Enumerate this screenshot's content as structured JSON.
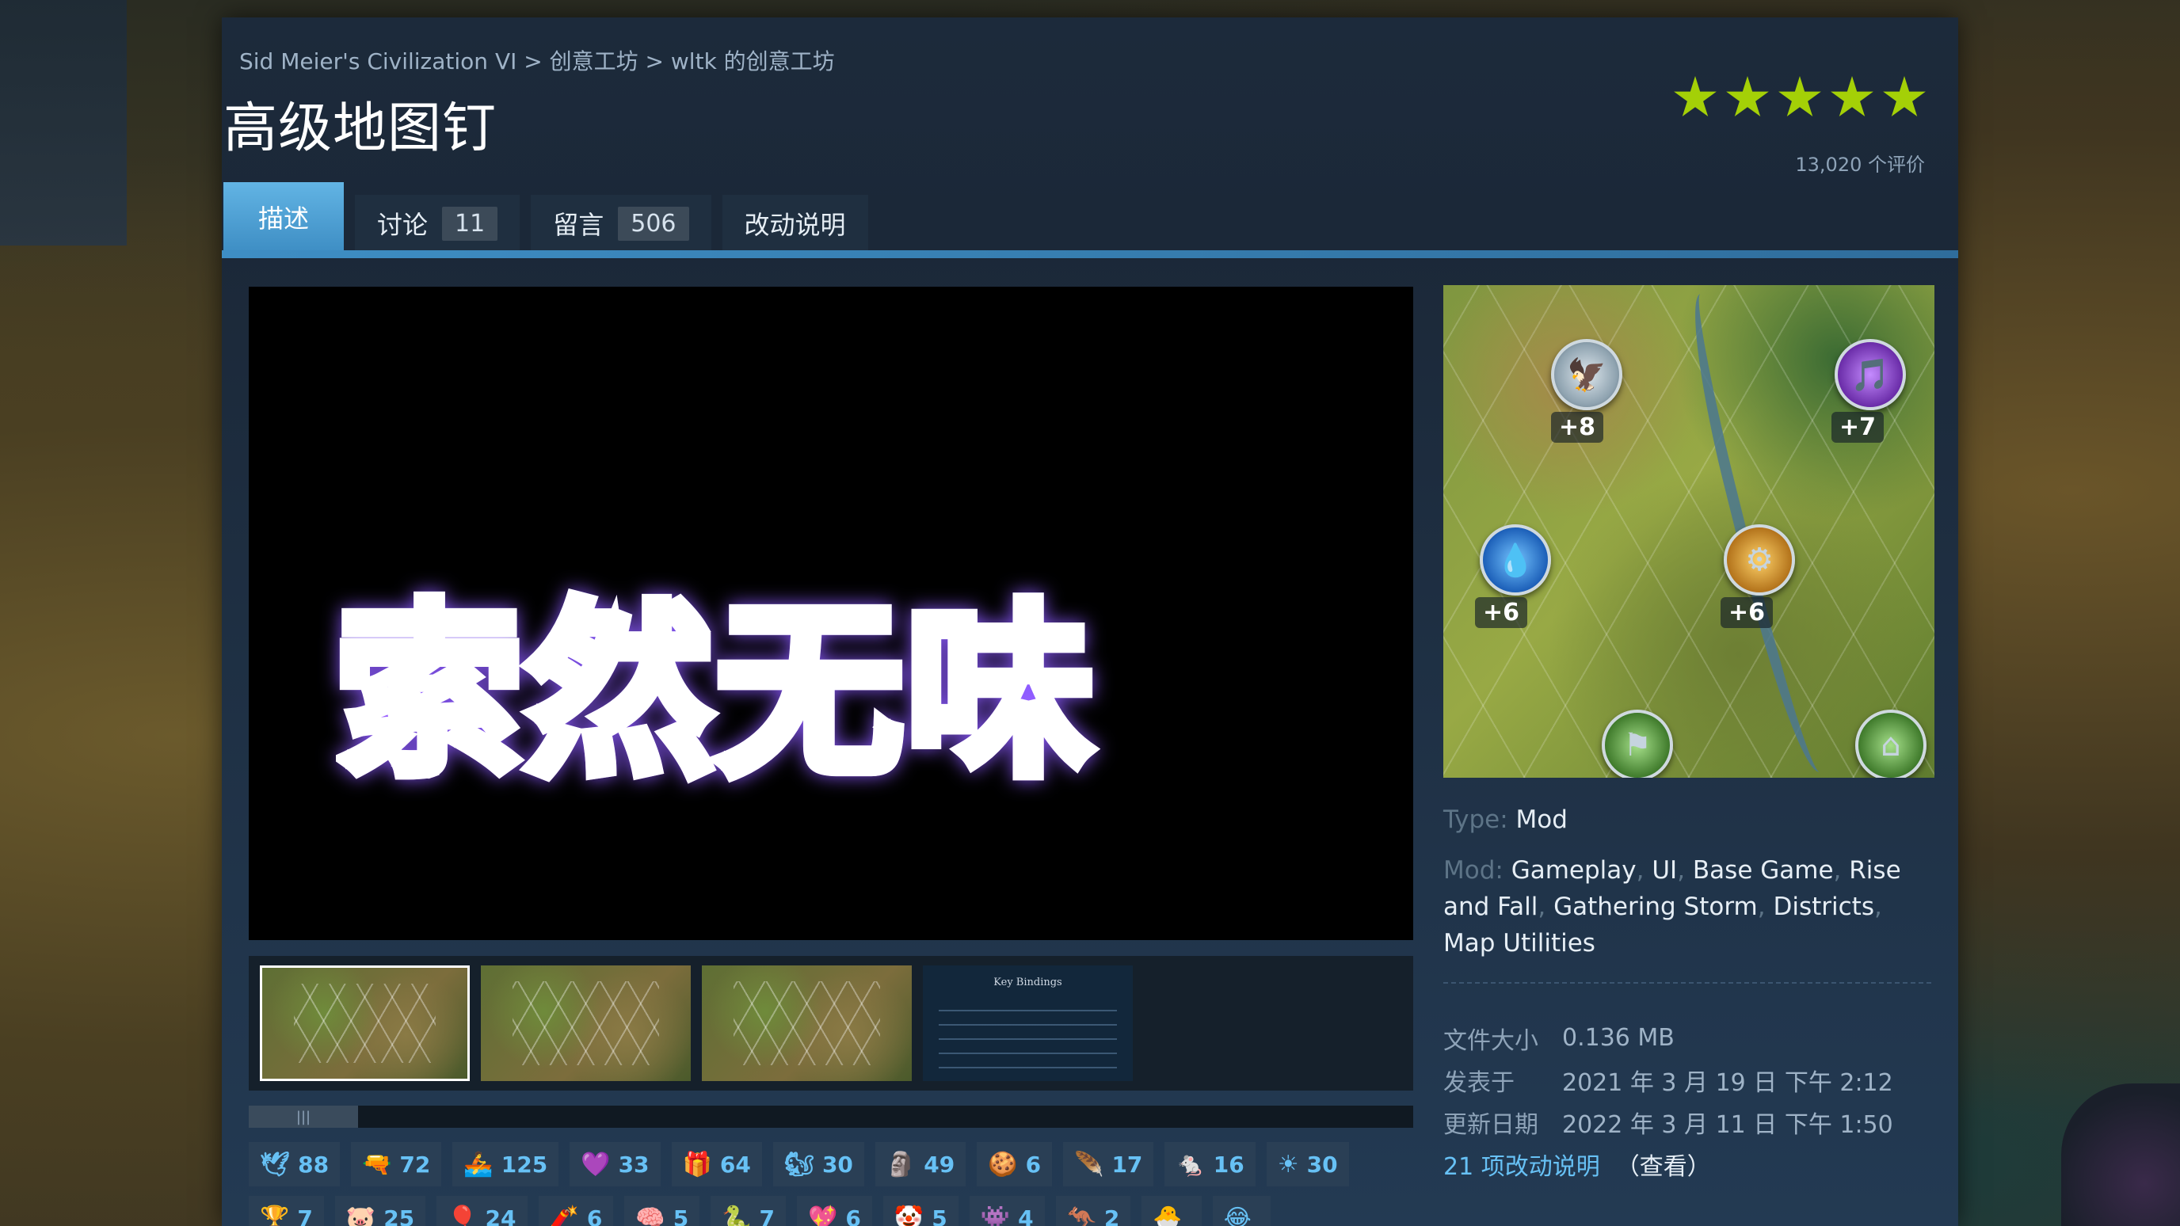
{
  "breadcrumb": {
    "game": "Sid Meier's Civilization VI",
    "sep1": " > ",
    "workshop": "创意工坊",
    "sep2": " > ",
    "author": "wltk 的创意工坊"
  },
  "item": {
    "title": "高级地图钉",
    "rating_count": "13,020 个评价",
    "stars": 5
  },
  "tabs": [
    {
      "label": "描述",
      "count": ""
    },
    {
      "label": "讨论",
      "count": "11"
    },
    {
      "label": "留言",
      "count": "506"
    },
    {
      "label": "改动说明",
      "count": ""
    }
  ],
  "media": {
    "overlay_caption": "索然无味",
    "keybind_thumb_title": "Key Bindings",
    "scroll_thumb": "|||"
  },
  "awards": [
    {
      "icon": "🕊",
      "count": "88"
    },
    {
      "icon": "🔫",
      "count": "72"
    },
    {
      "icon": "🚣",
      "count": "125"
    },
    {
      "icon": "💜",
      "count": "33"
    },
    {
      "icon": "🎁",
      "count": "64"
    },
    {
      "icon": "🐿",
      "count": "30"
    },
    {
      "icon": "🗿",
      "count": "49"
    },
    {
      "icon": "🍪",
      "count": "6"
    },
    {
      "icon": "🪶",
      "count": "17"
    },
    {
      "icon": "🐁",
      "count": "16"
    },
    {
      "icon": "☀",
      "count": "30"
    },
    {
      "icon": "🏆",
      "count": "7"
    },
    {
      "icon": "🐷",
      "count": "25"
    },
    {
      "icon": "🎈",
      "count": "24"
    },
    {
      "icon": "🧨",
      "count": "6"
    },
    {
      "icon": "🧠",
      "count": "5"
    },
    {
      "icon": "🐍",
      "count": "7"
    },
    {
      "icon": "💖",
      "count": "6"
    },
    {
      "icon": "🤡",
      "count": "5"
    },
    {
      "icon": "👾",
      "count": "4"
    },
    {
      "icon": "🦘",
      "count": "2"
    },
    {
      "icon": "🐣",
      "count": ""
    },
    {
      "icon": "😂",
      "count": ""
    }
  ],
  "preview": {
    "yields": [
      "+8",
      "+7",
      "+6",
      "+6"
    ]
  },
  "meta": {
    "type_label": "Type:",
    "type_value": "Mod",
    "mod_label": "Mod:",
    "tags": [
      "Gameplay",
      ", ",
      "UI",
      ", ",
      "Base Game",
      ", ",
      "Rise and Fall",
      ", ",
      "Gathering Storm",
      ", ",
      "Districts",
      ", ",
      "Map Utilities"
    ]
  },
  "details": {
    "size_label": "文件大小",
    "size_value": "0.136 MB",
    "posted_label": "发表于",
    "posted_value": "2021 年 3 月 19 日 下午 2:12",
    "updated_label": "更新日期",
    "updated_value": "2022 年 3 月 11 日 下午 1:50",
    "changes_link": "21 项改动说明",
    "changes_view": "（查看）"
  },
  "colors": {
    "panel": "#1b2838",
    "accent": "#67c1f5",
    "star": "#a4d007",
    "tab_active": "#62b4e4"
  }
}
